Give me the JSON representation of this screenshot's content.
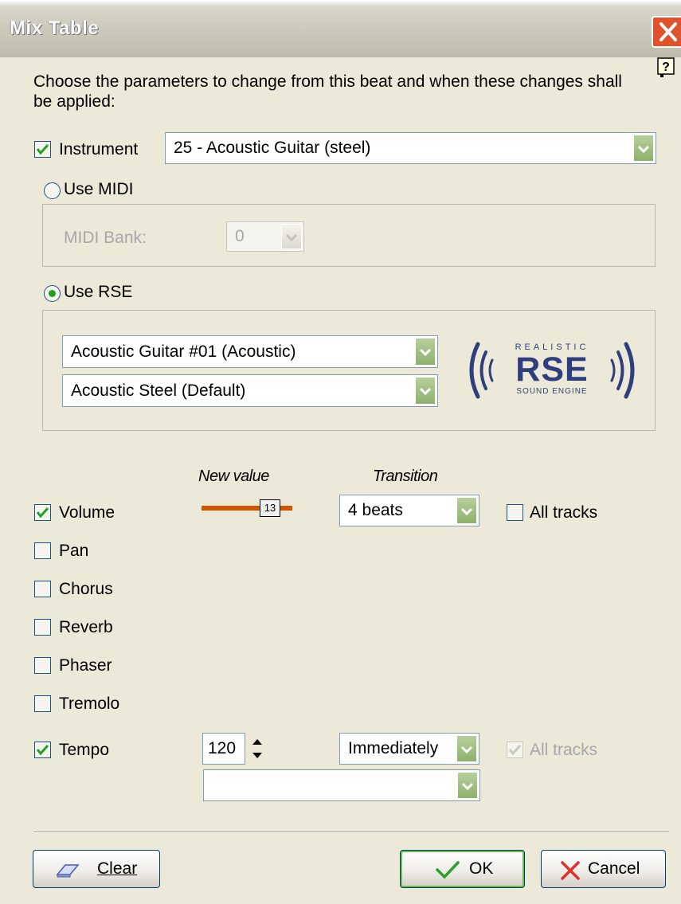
{
  "window": {
    "title": "Mix Table"
  },
  "intro": "Choose the parameters to change from this beat and when these changes shall be applied:",
  "intro_line1": "Choose the parameters to change from this beat and when these changes shall",
  "intro_line2": "be applied:",
  "instrument": {
    "label": "Instrument",
    "checked": true,
    "value": "25 - Acoustic Guitar (steel)"
  },
  "midi": {
    "radio_label": "Use MIDI",
    "bank_label": "MIDI Bank:",
    "bank_value": "0"
  },
  "rse": {
    "radio_label": "Use RSE",
    "instrument_value": "Acoustic Guitar #01 (Acoustic)",
    "soundbank_value": "Acoustic Steel (Default)",
    "logo": {
      "top": "REALISTIC",
      "main": "RSE",
      "bottom": "SOUND ENGINE"
    }
  },
  "columns": {
    "new_value": "New value",
    "transition": "Transition"
  },
  "params": {
    "volume": {
      "label": "Volume",
      "checked": true,
      "value": "13",
      "transition": "4 beats",
      "all_tracks": "All tracks"
    },
    "pan": {
      "label": "Pan",
      "checked": false
    },
    "chorus": {
      "label": "Chorus",
      "checked": false
    },
    "reverb": {
      "label": "Reverb",
      "checked": false
    },
    "phaser": {
      "label": "Phaser",
      "checked": false
    },
    "tremolo": {
      "label": "Tremolo",
      "checked": false
    },
    "tempo": {
      "label": "Tempo",
      "checked": true,
      "value": "120",
      "transition": "Immediately",
      "all_tracks": "All tracks",
      "extra_value": ""
    }
  },
  "buttons": {
    "clear": "Clear",
    "ok": "OK",
    "cancel": "Cancel"
  },
  "colors": {
    "accent_orange": "#d35400",
    "rse_blue": "#2f3f7e",
    "check_green": "#21a121",
    "close_red": "#e0522c"
  }
}
